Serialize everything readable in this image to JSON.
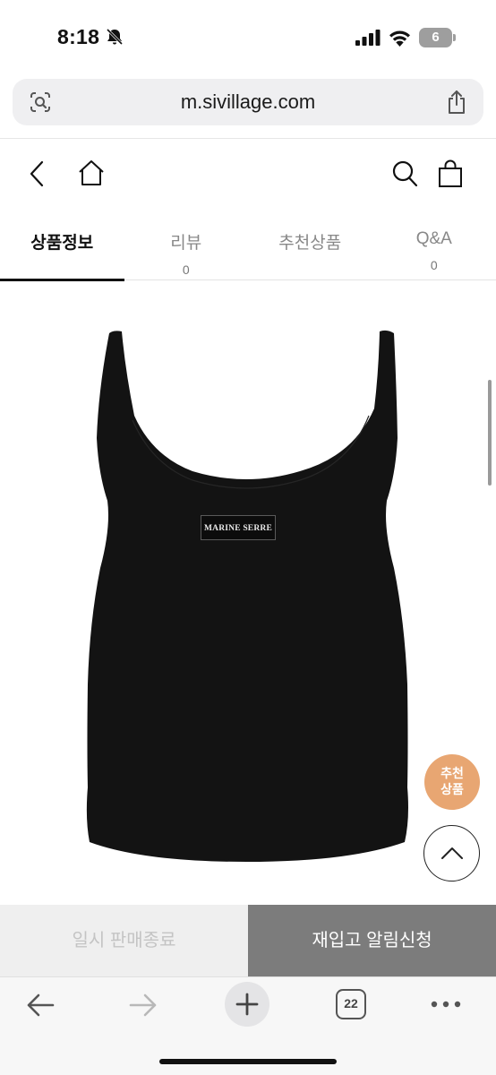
{
  "status_bar": {
    "time": "8:18",
    "battery_level": "6",
    "icons": [
      "bell-slash-icon",
      "cellular-signal-icon",
      "wifi-icon",
      "battery-icon"
    ]
  },
  "browser": {
    "url": "m.sivillage.com",
    "tab_count": "22",
    "icons": [
      "visual-lookup-icon",
      "share-icon",
      "back-arrow-icon",
      "forward-arrow-icon",
      "plus-icon",
      "tabs-icon",
      "more-icon"
    ]
  },
  "header": {
    "icons": [
      "chevron-left-icon",
      "home-icon",
      "search-icon",
      "shopping-bag-icon"
    ]
  },
  "tabs": [
    {
      "label": "상품정보",
      "count": "",
      "active": true
    },
    {
      "label": "리뷰",
      "count": "0",
      "active": false
    },
    {
      "label": "추천상품",
      "count": "",
      "active": false
    },
    {
      "label": "Q&A",
      "count": "0",
      "active": false
    }
  ],
  "product": {
    "brand_label": "MARINE SERRE",
    "garment_color": "#131313"
  },
  "floating": {
    "recommend_line1": "추천",
    "recommend_line2": "상품",
    "recommend_color": "#e8a672"
  },
  "actions": {
    "soldout_label": "일시 판매종료",
    "restock_label": "재입고 알림신청"
  }
}
